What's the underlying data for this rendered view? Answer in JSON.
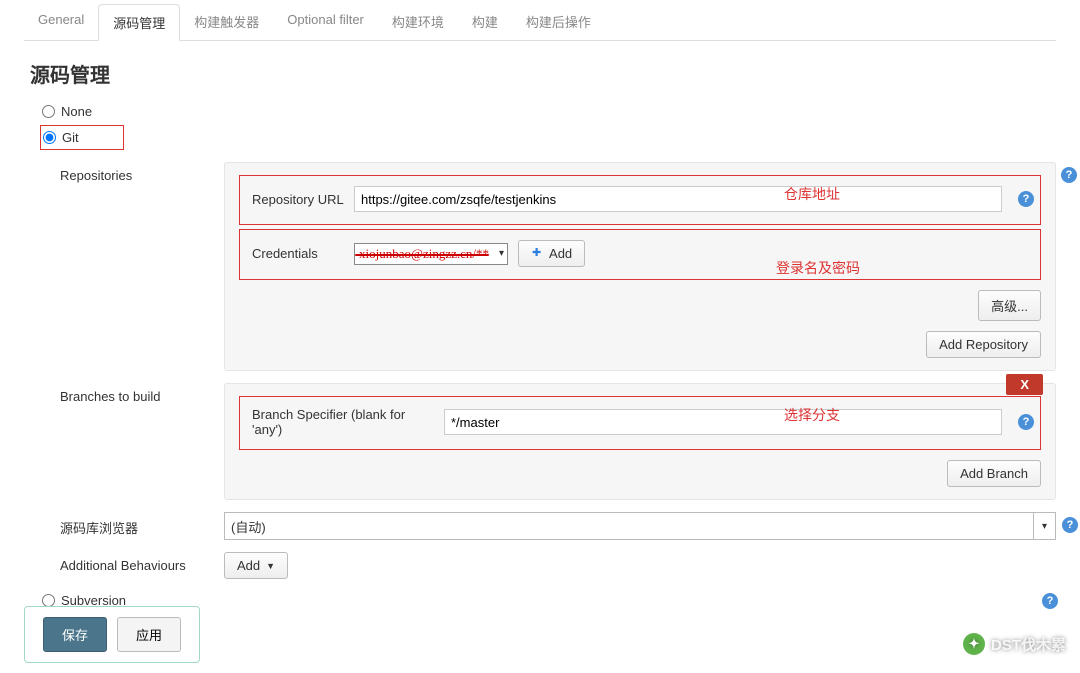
{
  "tabs": {
    "general": "General",
    "scm": "源码管理",
    "triggers": "构建触发器",
    "optional_filter": "Optional filter",
    "build_env": "构建环境",
    "build": "构建",
    "post_build": "构建后操作"
  },
  "section_title": "源码管理",
  "scm_options": {
    "none": "None",
    "git": "Git",
    "subversion": "Subversion"
  },
  "git": {
    "repositories_label": "Repositories",
    "repo_url_label": "Repository URL",
    "repo_url_value": "https://gitee.com/zsqfe/testjenkins",
    "credentials_label": "Credentials",
    "credentials_value_masked": "xiojunbao@zingzz.cn/**",
    "add_button": "Add",
    "advanced_button": "高级...",
    "add_repository_button": "Add Repository",
    "branches_label": "Branches to build",
    "branch_specifier_label": "Branch Specifier (blank for 'any')",
    "branch_specifier_value": "*/master",
    "delete_x": "X",
    "add_branch_button": "Add Branch",
    "repo_browser_label": "源码库浏览器",
    "repo_browser_value": "(自动)",
    "additional_behaviours_label": "Additional Behaviours",
    "add_behaviour_button": "Add"
  },
  "annotations": {
    "repo_url": "仓库地址",
    "credentials": "登录名及密码",
    "branch": "选择分支"
  },
  "footer": {
    "save": "保存",
    "apply": "应用"
  },
  "watermark": "DST伐木累"
}
